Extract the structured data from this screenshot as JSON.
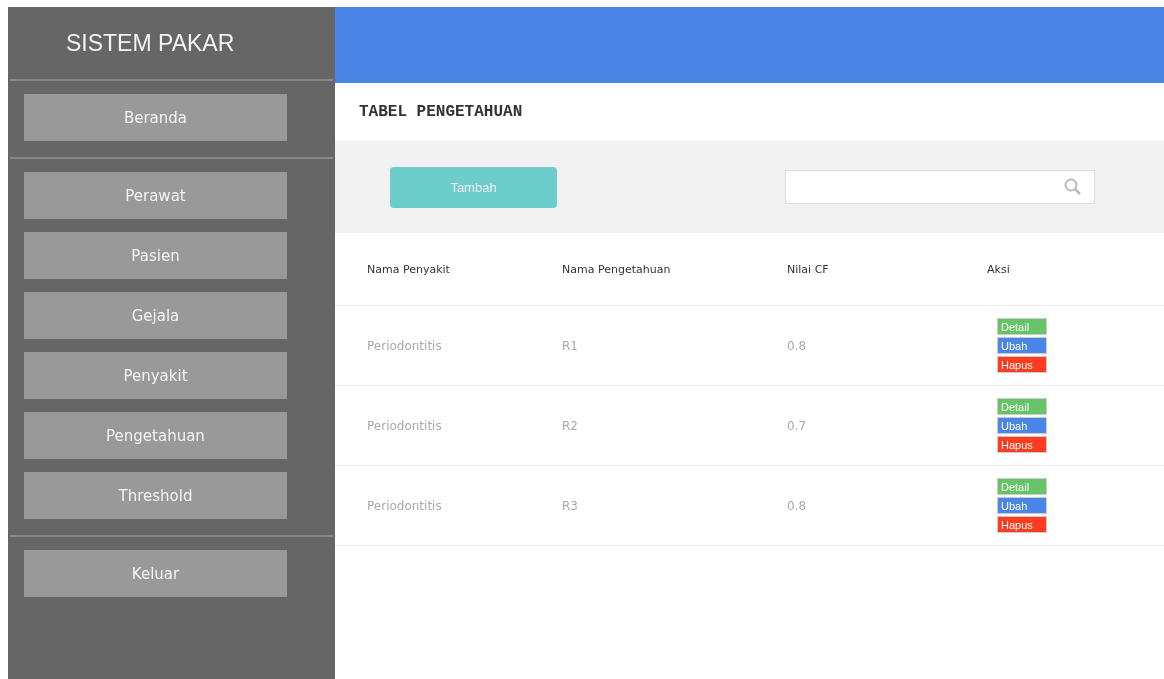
{
  "sidebar": {
    "title": "SISTEM PAKAR",
    "groups": [
      {
        "items": [
          "Beranda"
        ]
      },
      {
        "items": [
          "Perawat",
          "Pasien",
          "Gejala",
          "Penyakit",
          "Pengetahuan",
          "Threshold"
        ]
      },
      {
        "items": [
          "Keluar"
        ]
      }
    ]
  },
  "page_title": "TABEL PENGETAHUAN",
  "add_button": "Tambah",
  "table": {
    "columns": [
      "Nama Penyakit",
      "Nama Pengetahuan",
      "Nilai CF",
      "Aksi"
    ],
    "rows": [
      {
        "penyakit": "Periodontitis",
        "pengetahuan": "R1",
        "cf": "0.8",
        "actions": [
          {
            "kind": "detail",
            "label": "Detail"
          },
          {
            "kind": "ubah",
            "label": "Ubah"
          },
          {
            "kind": "hapus",
            "label": "Hapus"
          }
        ]
      },
      {
        "penyakit": "Periodontitis",
        "pengetahuan": "R2",
        "cf": "0.7",
        "actions": [
          {
            "kind": "detail",
            "label": "Detail"
          },
          {
            "kind": "ubah",
            "label": "Ubah"
          },
          {
            "kind": "hapus",
            "label": "Hapus"
          }
        ]
      },
      {
        "penyakit": "Periodontitis",
        "pengetahuan": "R3",
        "cf": "0.8",
        "actions": [
          {
            "kind": "detail",
            "label": "Detail"
          },
          {
            "kind": "ubah",
            "label": "Ubah"
          },
          {
            "kind": "hapus",
            "label": "Hapus"
          }
        ]
      }
    ]
  }
}
